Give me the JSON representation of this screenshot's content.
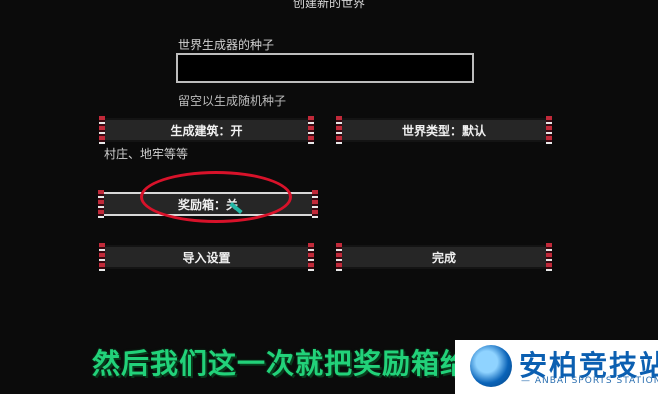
{
  "page": {
    "title": "创建新的世界"
  },
  "seed": {
    "label": "世界生成器的种子",
    "value": "",
    "hint": "留空以生成随机种子"
  },
  "buttons": {
    "generate_structures": "生成建筑：开",
    "world_type": "世界类型：默认",
    "bonus_chest": "奖励箱：关",
    "import_settings": "导入设置",
    "done": "完成"
  },
  "hints": {
    "structures": "村庄、地牢等等"
  },
  "overlay": {
    "subtitle": "然后我们这一次就把奖励箱给"
  },
  "logo": {
    "main": "安柏竞技站",
    "sub": "— ANBAI SPORTS STATION —"
  },
  "colors": {
    "annotation": "#d8122a",
    "subtitle": "#22d27a",
    "logo": "#0b5fb1"
  }
}
